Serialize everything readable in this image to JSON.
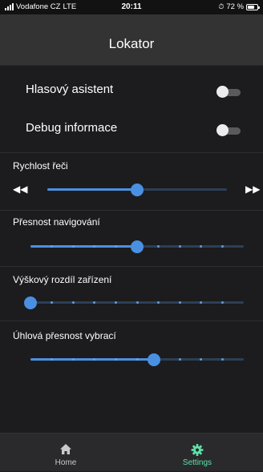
{
  "status_bar": {
    "carrier": "Vodafone CZ",
    "network": "LTE",
    "time": "20:11",
    "battery_text": "72 %",
    "battery_level": 0.72
  },
  "header": {
    "title": "Lokator"
  },
  "settings": {
    "voice_assistant": {
      "label": "Hlasový asistent",
      "enabled": false
    },
    "debug_info": {
      "label": "Debug informace",
      "enabled": false
    },
    "speech_rate": {
      "label": "Rychlost řeči",
      "value": 0.5
    },
    "navigation_precision": {
      "label": "Přesnost navigování",
      "value": 0.5,
      "steps": 10
    },
    "height_difference": {
      "label": "Výškový rozdíl zařízení",
      "value": 0.0,
      "steps": 10
    },
    "angular_precision": {
      "label": "Úhlová přesnost vybrací",
      "value": 0.58,
      "steps": 10
    }
  },
  "tab_bar": {
    "home": {
      "label": "Home",
      "icon": "home-icon",
      "active": false
    },
    "settings": {
      "label": "Settings",
      "icon": "gear-icon",
      "active": true
    }
  },
  "colors": {
    "accent": "#4a90e2",
    "active_tab": "#5fe0a8",
    "inactive_tab": "#c9c9c9"
  }
}
